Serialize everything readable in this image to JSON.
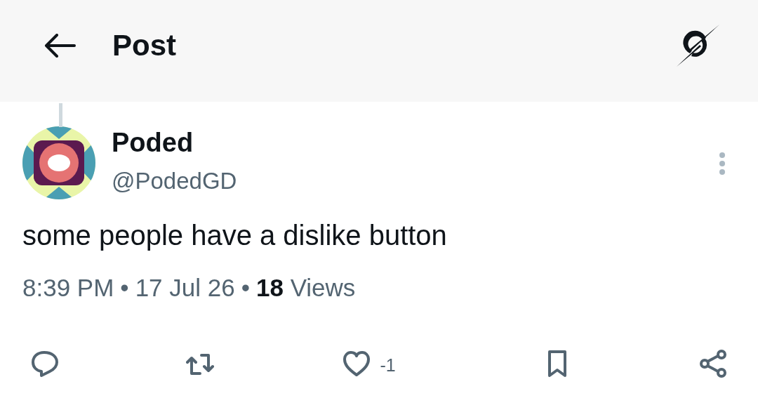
{
  "header": {
    "title": "Post"
  },
  "post": {
    "author": {
      "name": "Poded",
      "handle": "@PodedGD"
    },
    "text": "some people have a dislike button",
    "time": "8:39 PM",
    "separator_1": "•",
    "date": "17 Jul 26",
    "separator_2": "•",
    "views_count": "18",
    "views_label": "Views"
  },
  "actions": [
    {
      "kind": "reply"
    },
    {
      "kind": "repost"
    },
    {
      "kind": "like",
      "count": "-1"
    },
    {
      "kind": "bookmark"
    },
    {
      "kind": "share"
    }
  ]
}
